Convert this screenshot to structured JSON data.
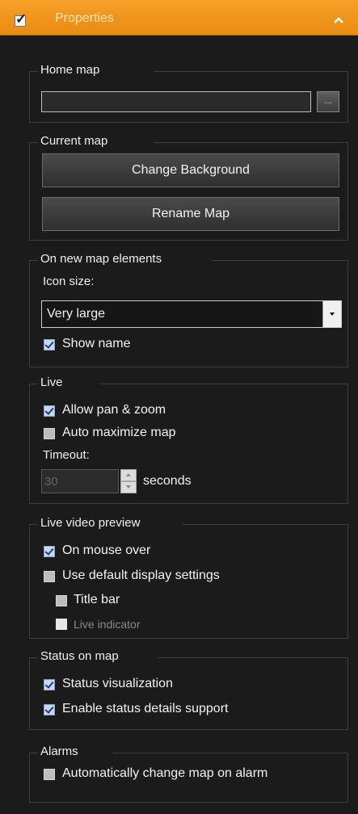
{
  "header": {
    "title": "Properties",
    "checked": true,
    "collapse_icon": "chevron-up-icon",
    "accent": "#f39a1f"
  },
  "home_map": {
    "legend": "Home map",
    "value": "",
    "browse_label": "..."
  },
  "current_map": {
    "legend": "Current map",
    "change_background_label": "Change Background",
    "rename_map_label": "Rename Map"
  },
  "new_elements": {
    "legend": "On new map elements",
    "icon_size_label": "Icon size:",
    "icon_size_value": "Very large",
    "show_name_label": "Show name",
    "show_name_checked": true
  },
  "live": {
    "legend": "Live",
    "allow_pan_zoom_label": "Allow pan & zoom",
    "allow_pan_zoom_checked": true,
    "auto_maximize_label": "Auto maximize map",
    "auto_maximize_checked": false,
    "timeout_label": "Timeout:",
    "timeout_value": "30",
    "timeout_unit": "seconds"
  },
  "live_preview": {
    "legend": "Live video preview",
    "on_mouse_over_label": "On mouse over",
    "on_mouse_over_checked": true,
    "use_default_label": "Use default display settings",
    "use_default_checked": false,
    "title_bar_label": "Title bar",
    "title_bar_checked": false,
    "live_indicator_label": "Live indicator",
    "live_indicator_checked": false
  },
  "status_on_map": {
    "legend": "Status on map",
    "status_visualization_label": "Status visualization",
    "status_visualization_checked": true,
    "status_details_label": "Enable status details support",
    "status_details_checked": true
  },
  "alarms": {
    "legend": "Alarms",
    "auto_change_label": "Automatically change map on alarm",
    "auto_change_checked": false
  }
}
